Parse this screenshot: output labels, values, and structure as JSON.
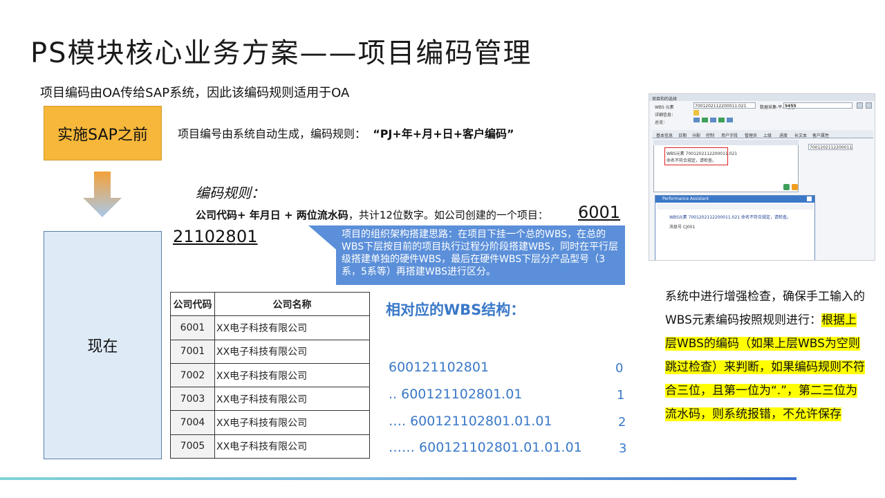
{
  "title": "PS模块核心业务方案——项目编码管理",
  "subtitle": "项目编码由OA传给SAP系统，因此该编码规则适用于OA",
  "before": {
    "label": "实施SAP之前",
    "text_prefix": "项目编号由系统自动生成，编码规则：",
    "text_rule": "“PJ+年+月+日+客户编码”"
  },
  "now": {
    "label": "现在"
  },
  "rule": {
    "heading": "编码规则：",
    "line_bold": "公司代码+ 年月日 + 两位流水码",
    "line_rest": "，共计12位数字。如公司创建的一个项目：",
    "code_part1": "6001",
    "code_part2": "211028",
    "code_part3": "01"
  },
  "callout": {
    "text": "项目的组织架构搭建思路：在项目下挂一个总的WBS，在总的WBS下层按目前的项目执行过程分阶段搭建WBS，同时在平行层级搭建单独的硬件WBS，最后在硬件WBS下层分产品型号（3系，5系等）再搭建WBS进行区分。"
  },
  "company_table": {
    "headers": [
      "公司代码",
      "公司名称"
    ],
    "rows": [
      [
        "6001",
        "XX电子科技有限公司"
      ],
      [
        "7001",
        "XX电子科技有限公司"
      ],
      [
        "7002",
        "XX电子科技有限公司"
      ],
      [
        "7003",
        "XX电子科技有限公司"
      ],
      [
        "7004",
        "XX电子科技有限公司"
      ],
      [
        "7005",
        "XX电子科技有限公司"
      ]
    ]
  },
  "wbs": {
    "heading": "相对应的WBS结构：",
    "rows": [
      {
        "code": "600121102801",
        "level": "0"
      },
      {
        "code": ".. 600121102801.01",
        "level": "1"
      },
      {
        "code": "…. 600121102801.01.01",
        "level": "2"
      },
      {
        "code": "…… 600121102801.01.01.01",
        "level": "3"
      }
    ]
  },
  "screenshot": {
    "header_label": "项目和的选择",
    "wbs_label": "WBS 元素",
    "wbs_value": "7001202112200011.021",
    "desc_label": "数据采集-平人运送",
    "desc_value": "5455",
    "detail_label": "详细信息：",
    "status_label": "总览：",
    "tabs": [
      "基本信息",
      "日期",
      "分配",
      "控制",
      "用户字段",
      "管理员",
      "上级",
      "进度",
      "长文本",
      "客户属性"
    ],
    "field_value": "7001202112200011.",
    "err_line1": "WBS元素 7001202112200011.021",
    "err_line2": "命名不符合规定，请检查。",
    "pa_title": "Performance Assistant",
    "pa_line1": "WBS元素 7001202112200011.021 命名不符合规定，请检查。",
    "pa_line2": "消息号 CJ001"
  },
  "note": {
    "plain": "系统中进行增强检查，确保手工输入的WBS元素编码按照规则进行：",
    "highlight": "根据上层WBS的编码（如果上层WBS为空则跳过检查）来判断，如果编码规则不符合三位，且第一位为“.”，第二三位为流水码，则系统报错，不允许保存"
  },
  "colors": {
    "before_box": "#f6b73a",
    "now_box": "#deebf7",
    "callout": "#5b8fd9",
    "wbs_text": "#3a78c8",
    "highlight": "#ffff00"
  }
}
